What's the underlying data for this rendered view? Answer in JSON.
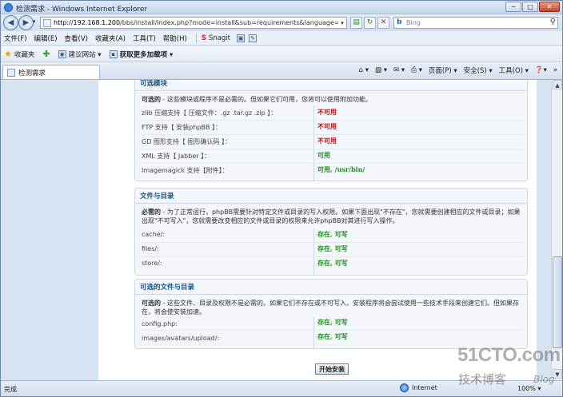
{
  "window": {
    "title": "检测需求 - Windows Internet Explorer",
    "buttons": {
      "minimize": "─",
      "maximize": "□",
      "close": "✕"
    }
  },
  "address": {
    "url_host": "http://192.168.1.200",
    "url_path": "/bbs/install/index.php?mode=install&sub=requirements&language=zh_cmn",
    "search_placeholder": "Bing"
  },
  "menu": {
    "items": [
      "文件(F)",
      "编辑(E)",
      "查看(V)",
      "收藏夹(A)",
      "工具(T)",
      "帮助(H)"
    ],
    "snagit": "Snagit"
  },
  "favorites": {
    "label": "收藏夹",
    "suggested": "建议网站 ▾",
    "gallery": "获取更多加载项 ▾"
  },
  "tab": {
    "label": "检测需求"
  },
  "commandbar": {
    "page": "页面(P) ▾",
    "safety": "安全(S) ▾",
    "tools": "工具(O) ▾",
    "help": "▾"
  },
  "optional_modules": {
    "header": "可选模块",
    "desc_lead": "可选的",
    "desc": " - 这些模块或程序不是必需的。但如果它们可用，您将可以使用附加功能。",
    "rows": [
      {
        "label": "zlib 压缩支持【 压缩文件：.gz .tar.gz .zip 】：",
        "value": "不可用",
        "status": "bad"
      },
      {
        "label": "FTP 支持【 安装phpBB 】：",
        "value": "不可用",
        "status": "bad"
      },
      {
        "label": "GD 图形支持【 图形确认码 】：",
        "value": "不可用",
        "status": "bad"
      },
      {
        "label": "XML 支持【 Jabber 】：",
        "value": "可用",
        "status": "good"
      },
      {
        "label": "Imagemagick 支持【附件】：",
        "value": "可用, /usr/bin/",
        "status": "good"
      }
    ]
  },
  "files_dirs": {
    "header": "文件与目录",
    "desc_lead": "必需的",
    "desc": " - 为了正常运行，phpBB需要针对特定文件或目录的写入权限。如果下面出现\"不存在\"，您就需要创建相应的文件或目录；如果出现\"不可写入\"，您就需要改变相应的文件或目录的权限来允许phpBB对其进行写入操作。",
    "rows": [
      {
        "label": "cache/:",
        "value": "存在, 可写"
      },
      {
        "label": "files/:",
        "value": "存在, 可写"
      },
      {
        "label": "store/:",
        "value": "存在, 可写"
      }
    ]
  },
  "optional_files": {
    "header": "可选的文件与目录",
    "desc_lead": "可选的",
    "desc": " - 这些文件、目录及权限不是必需的。如果它们不存在或不可写入，安装程序将会尝试使用一些技术手段来创建它们。但如果存在，将会使安装加速。",
    "rows": [
      {
        "label": "config.php:",
        "value": "存在, 可写"
      },
      {
        "label": "images/avatars/upload/:",
        "value": "存在, 可写"
      }
    ]
  },
  "submit_label": "开始安装",
  "status": {
    "left": "完成",
    "zone": "Internet",
    "zoom": "100% ▾"
  },
  "watermark": {
    "brand": "51CTO.com",
    "sub": "技术博客",
    "blog": "Blog"
  },
  "colors": {
    "bad": "#cc0000",
    "good": "#228b22",
    "header": "#105289"
  }
}
